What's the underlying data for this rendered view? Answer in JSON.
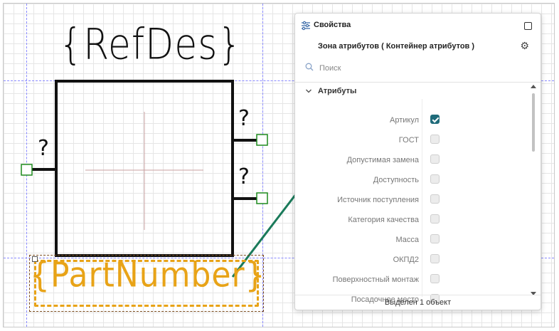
{
  "canvas": {
    "refdes_label": "{RefDes}",
    "partnumber_label": "{PartNumber}",
    "pin_labels": [
      "?",
      "?",
      "?"
    ],
    "colors": {
      "pin_marker": "#1d8a1d",
      "partnumber": "#e8a317",
      "arrow": "#1a7a5a",
      "guide": "#8a8aff"
    }
  },
  "panel": {
    "title": "Свойства",
    "title_icon": "sliders-icon",
    "object_name": "Зона атрибутов ( Контейнер атрибутов )",
    "search_placeholder": "Поиск",
    "section_title": "Атрибуты",
    "attributes": [
      {
        "label": "Артикул",
        "checked": true
      },
      {
        "label": "ГОСТ",
        "checked": false
      },
      {
        "label": "Допустимая замена",
        "checked": false
      },
      {
        "label": "Доступность",
        "checked": false
      },
      {
        "label": "Источник поступления",
        "checked": false
      },
      {
        "label": "Категория качества",
        "checked": false
      },
      {
        "label": "Масса",
        "checked": false
      },
      {
        "label": "ОКПД2",
        "checked": false
      },
      {
        "label": "Поверхностный монтаж",
        "checked": false
      },
      {
        "label": "Посадочное место",
        "checked": false
      }
    ],
    "status": "Выделен 1 объект",
    "accent_color": "#1f6b7a"
  }
}
